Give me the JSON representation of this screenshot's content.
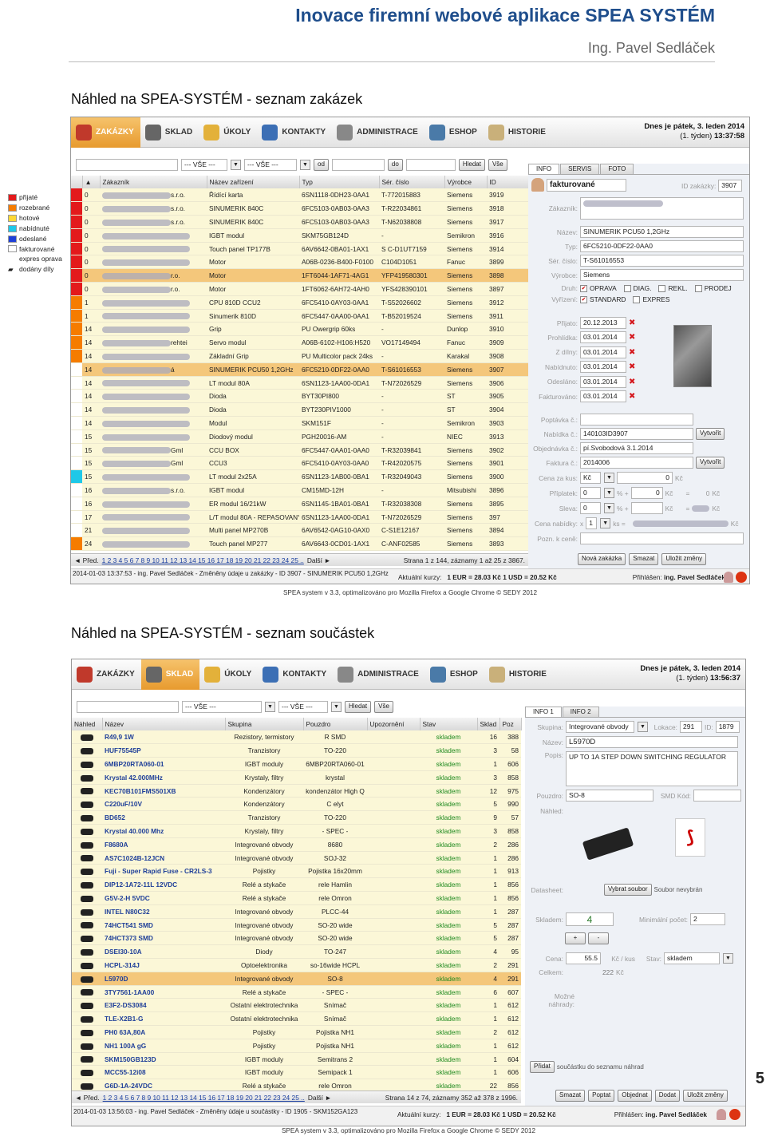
{
  "doc": {
    "title": "Inovace firemní webové aplikace SPEA SYSTÉM",
    "author": "Ing. Pavel Sedláček",
    "page_number": "5",
    "caption1": "Náhled na SPEA-SYSTÉM - seznam zakázek",
    "caption2": "Náhled na SPEA-SYSTÉM - seznam součástek"
  },
  "legend": [
    {
      "label": "přijaté",
      "color": "#e31a1c"
    },
    {
      "label": "rozebrané",
      "color": "#f57c00"
    },
    {
      "label": "hotové",
      "color": "#fdd835"
    },
    {
      "label": "nabídnuté",
      "color": "#1ec8e8"
    },
    {
      "label": "odeslané",
      "color": "#1e40d8"
    },
    {
      "label": "fakturované",
      "color": "#ffffff"
    },
    {
      "label": "expres oprava",
      "color": ""
    },
    {
      "label": "dodány díly",
      "color": ""
    }
  ],
  "nav": [
    "ZAKÁZKY",
    "SKLAD",
    "ÚKOLY",
    "KONTAKTY",
    "ADMINISTRACE",
    "ESHOP",
    "HISTORIE"
  ],
  "shot1": {
    "date1": "Dnes je pátek, 3. leden 2014",
    "week": "(1. týden)",
    "time": "13:37:58",
    "filter": {
      "all1": "--- VŠE ---",
      "all2": "--- VŠE ---",
      "od": "od",
      "do": "do",
      "search": "Hledat",
      "all_btn": "Vše"
    },
    "columns": [
      "Zákazník",
      "Název zařízení",
      "Typ",
      "Sér. číslo",
      "Výrobce",
      "ID"
    ],
    "rows": [
      {
        "c": "0",
        "cust": "s.r.o.",
        "name": "Řídící karta",
        "type": "6SN1118-0DH23-0AA1",
        "sn": "T-772015883",
        "mfr": "Siemens",
        "id": "3919",
        "flag": "#e31a1c"
      },
      {
        "c": "0",
        "cust": "s.r.o.",
        "name": "SINUMERIK 840C",
        "type": "6FC5103-0AB03-0AA3",
        "sn": "T-R22034861",
        "mfr": "Siemens",
        "id": "3918",
        "flag": "#e31a1c"
      },
      {
        "c": "0",
        "cust": "s.r.o.",
        "name": "SINUMERIK 840C",
        "type": "6FC5103-0AB03-0AA3",
        "sn": "T-N62038808",
        "mfr": "Siemens",
        "id": "3917",
        "flag": "#e31a1c"
      },
      {
        "c": "0",
        "cust": "",
        "name": "IGBT modul",
        "type": "SKM75GB124D",
        "sn": "-",
        "mfr": "Semikron",
        "id": "3916",
        "flag": "#e31a1c"
      },
      {
        "c": "0",
        "cust": "",
        "name": "Touch panel TP177B",
        "type": "6AV6642-0BA01-1AX1",
        "sn": "S C-D1UT7159",
        "mfr": "Siemens",
        "id": "3914",
        "flag": "#e31a1c"
      },
      {
        "c": "0",
        "cust": "",
        "name": "Motor",
        "type": "A06B-0236-B400-F0100",
        "sn": "C104D1051",
        "mfr": "Fanuc",
        "id": "3899",
        "flag": "#e31a1c"
      },
      {
        "c": "0",
        "cust": "r.o.",
        "name": "Motor",
        "type": "1FT6044-1AF71-4AG1",
        "sn": "YFP419580301",
        "mfr": "Siemens",
        "id": "3898",
        "flag": "#e31a1c",
        "sel": true
      },
      {
        "c": "0",
        "cust": "r.o.",
        "name": "Motor",
        "type": "1FT6062-6AH72-4AH0",
        "sn": "YFS428390101",
        "mfr": "Siemens",
        "id": "3897",
        "flag": "#e31a1c"
      },
      {
        "c": "1",
        "cust": "",
        "name": "CPU 810D CCU2",
        "type": "6FC5410-0AY03-0AA1",
        "sn": "T-S52026602",
        "mfr": "Siemens",
        "id": "3912",
        "flag": "#f57c00"
      },
      {
        "c": "1",
        "cust": "",
        "name": "Sinumerik 810D",
        "type": "6FC5447-0AA00-0AA1",
        "sn": "T-B52019524",
        "mfr": "Siemens",
        "id": "3911",
        "flag": "#f57c00"
      },
      {
        "c": "14",
        "cust": "",
        "name": "Grip",
        "type": "PU Owergrip 60ks",
        "sn": "-",
        "mfr": "Dunlop",
        "id": "3910",
        "flag": "#f57c00"
      },
      {
        "c": "14",
        "cust": "rehtei",
        "name": "Servo modul",
        "type": "A06B-6102-H106:H520",
        "sn": "VO17149494",
        "mfr": "Fanuc",
        "id": "3909",
        "flag": "#f57c00"
      },
      {
        "c": "14",
        "cust": "",
        "name": "Základní Grip",
        "type": "PU Multicolor pack 24ks",
        "sn": "-",
        "mfr": "Karakal",
        "id": "3908",
        "flag": "#f57c00"
      },
      {
        "c": "14",
        "cust": "á",
        "name": "SINUMERIK PCU50 1,2GHz",
        "type": "6FC5210-0DF22-0AA0",
        "sn": "T-S61016553",
        "mfr": "Siemens",
        "id": "3907",
        "flag": "#ffffff",
        "sel": true
      },
      {
        "c": "14",
        "cust": "",
        "name": "LT modul 80A",
        "type": "6SN1123-1AA00-0DA1",
        "sn": "T-N72026529",
        "mfr": "Siemens",
        "id": "3906",
        "flag": "#ffffff"
      },
      {
        "c": "14",
        "cust": "",
        "name": "Dioda",
        "type": "BYT30PI800",
        "sn": "-",
        "mfr": "ST",
        "id": "3905",
        "flag": "#ffffff"
      },
      {
        "c": "14",
        "cust": "",
        "name": "Dioda",
        "type": "BYT230PIV1000",
        "sn": "-",
        "mfr": "ST",
        "id": "3904",
        "flag": "#ffffff"
      },
      {
        "c": "14",
        "cust": "",
        "name": "Modul",
        "type": "SKM151F",
        "sn": "-",
        "mfr": "Semikron",
        "id": "3903",
        "flag": "#ffffff"
      },
      {
        "c": "15",
        "cust": "",
        "name": "Diodový modul",
        "type": "PGH20016-AM",
        "sn": "-",
        "mfr": "NIEC",
        "id": "3913",
        "flag": "#ffffff"
      },
      {
        "c": "15",
        "cust": "Gml",
        "name": "CCU BOX",
        "type": "6FC5447-0AA01-0AA0",
        "sn": "T-R32039841",
        "mfr": "Siemens",
        "id": "3902",
        "flag": "#ffffff"
      },
      {
        "c": "15",
        "cust": "Gml",
        "name": "CCU3",
        "type": "6FC5410-0AY03-0AA0",
        "sn": "T-R42020575",
        "mfr": "Siemens",
        "id": "3901",
        "flag": "#ffffff"
      },
      {
        "c": "15",
        "cust": "",
        "name": "LT modul 2x25A",
        "type": "6SN1123-1AB00-0BA1",
        "sn": "T-R32049043",
        "mfr": "Siemens",
        "id": "3900",
        "flag": "#1ec8e8"
      },
      {
        "c": "16",
        "cust": "s.r.o.",
        "name": "IGBT modul",
        "type": "CM15MD-12H",
        "sn": "-",
        "mfr": "Mitsubishi",
        "id": "3896",
        "flag": "#ffffff"
      },
      {
        "c": "16",
        "cust": "",
        "name": "ER modul 16/21kW",
        "type": "6SN1145-1BA01-0BA1",
        "sn": "T-R32038308",
        "mfr": "Siemens",
        "id": "3895",
        "flag": "#ffffff"
      },
      {
        "c": "17",
        "cust": "",
        "name": "L/T modul 80A - REPASOVANÝ",
        "type": "6SN1123-1AA00-0DA1",
        "sn": "T-N72026529",
        "mfr": "Siemens",
        "id": "397",
        "flag": "#ffffff"
      },
      {
        "c": "21",
        "cust": "",
        "name": "Multi panel MP270B",
        "type": "6AV6542-0AG10-0AX0",
        "sn": "C-S1E12167",
        "mfr": "Siemens",
        "id": "3894",
        "flag": "#ffffff"
      },
      {
        "c": "24",
        "cust": "",
        "name": "Touch panel MP277",
        "type": "6AV6643-0CD01-1AX1",
        "sn": "C-ANF02585",
        "mfr": "Siemens",
        "id": "3893",
        "flag": "#f57c00"
      }
    ],
    "pager": {
      "prev": "Před.",
      "pages": "1 2 3 4 5 6 7 8 9 10 11 12 13 14 15 16 17 18 19 20 21 22 23 24 25 ..",
      "next": "Další",
      "info": "Strana 1 z 144, záznamy 1 až 25 z 3867."
    },
    "status": {
      "log": "2014-01-03 13:37:53 - ing. Pavel Sedláček - Změněny údaje u zakázky - ID 3907 - SINUMERIK PCU50 1,2GHz",
      "rates": "Aktuální kurzy:",
      "rate_vals": "1 EUR = 28.03 Kč 1 USD = 20.52 Kč",
      "login_label": "Přihlášen:",
      "user": "ing. Pavel Sedláček"
    },
    "footer": "SPEA system v 3.3, optimalizováno pro Mozilla Firefox a Google Chrome © SEDY 2012",
    "panel": {
      "tabs": [
        "INFO",
        "SERVIS",
        "FOTO"
      ],
      "state": "fakturované",
      "id_label": "ID zakázky:",
      "id": "3907",
      "customer_label": "Zákazník:",
      "name_label": "Název:",
      "name": "SINUMERIK PCU50 1,2GHz",
      "type_label": "Typ:",
      "type": "6FC5210-0DF22-0AA0",
      "sn_label": "Sér. číslo:",
      "sn": "T-S61016553",
      "mfr_label": "Výrobce:",
      "mfr": "Siemens",
      "kind_label": "Druh:",
      "kind": [
        "OPRAVA",
        "DIAG.",
        "REKL.",
        "PRODEJ"
      ],
      "handle_label": "Vyřízení:",
      "handle": [
        "STANDARD",
        "EXPRES"
      ],
      "dates": [
        {
          "l": "Přijato:",
          "v": "20.12.2013"
        },
        {
          "l": "Prohlídka:",
          "v": "03.01.2014"
        },
        {
          "l": "Z dílny:",
          "v": "03.01.2014"
        },
        {
          "l": "Nabídnuto:",
          "v": "03.01.2014"
        },
        {
          "l": "Odesláno:",
          "v": "03.01.2014"
        },
        {
          "l": "Fakturováno:",
          "v": "03.01.2014"
        }
      ],
      "inquiry_label": "Poptávka č.:",
      "offer_label": "Nabídka č.:",
      "offer": "140103ID3907",
      "create": "Vytvořit",
      "order_label": "Objednávka č.:",
      "order": "pí.Svobodová 3.1.2014",
      "invoice_label": "Faktura č.:",
      "invoice": "2014006",
      "create2": "Vytvořit",
      "price_label": "Cena za kus:",
      "currency": "Kč",
      "price": "0",
      "price_unit": "Kč",
      "surcharge_label": "Příplatek:",
      "surcharge": "0",
      "pct": "% +",
      "surcharge_amt": "0",
      "sur_unit": "Kč",
      "eq": "=",
      "sur_total": "0",
      "sur_total_unit": "Kč",
      "discount_label": "Sleva:",
      "discount": "0",
      "pct2": "% +",
      "disc_unit": "Kč",
      "eq2": "=",
      "disc_total_unit": "Kč",
      "offer_price_label": "Cena nabídky:",
      "mult": "x",
      "qty": "1",
      "ks": "ks =",
      "op_unit": "Kč",
      "note_label": "Pozn. k ceně:",
      "buttons": [
        "Nová zakázka",
        "Smazat",
        "Uložit změny"
      ]
    }
  },
  "shot2": {
    "date1": "Dnes je pátek, 3. leden 2014",
    "week": "(1. týden)",
    "time": "13:56:37",
    "filter": {
      "all1": "--- VŠE ---",
      "all2": "--- VŠE ---",
      "search": "Hledat",
      "all_btn": "Vše"
    },
    "columns": [
      "Náhled",
      "Název",
      "Skupina",
      "Pouzdro",
      "Upozornění",
      "Stav",
      "Sklad",
      "Poz"
    ],
    "rows": [
      {
        "n": "R49,9 1W",
        "g": "Rezistory, termistory",
        "p": "R SMD",
        "s": "skladem",
        "q": "16",
        "pz": "388"
      },
      {
        "n": "HUF75545P",
        "g": "Tranzistory",
        "p": "TO-220",
        "s": "skladem",
        "q": "3",
        "pz": "58"
      },
      {
        "n": "6MBP20RTA060-01",
        "g": "IGBT moduly",
        "p": "6MBP20RTA060-01",
        "s": "skladem",
        "q": "1",
        "pz": "606"
      },
      {
        "n": "Krystal 42.000MHz",
        "g": "Krystaly, filtry",
        "p": "krystal",
        "s": "skladem",
        "q": "3",
        "pz": "858"
      },
      {
        "n": "KEC70B101FMS501XB",
        "g": "Kondenzátory",
        "p": "kondenzátor High Q",
        "s": "skladem",
        "q": "12",
        "pz": "975"
      },
      {
        "n": "C220uF/10V",
        "g": "Kondenzátory",
        "p": "C elyt",
        "s": "skladem",
        "q": "5",
        "pz": "990"
      },
      {
        "n": "BD652",
        "g": "Tranzistory",
        "p": "TO-220",
        "s": "skladem",
        "q": "9",
        "pz": "57"
      },
      {
        "n": "Krystal 40.000 Mhz",
        "g": "Krystaly, filtry",
        "p": "- SPEC -",
        "s": "skladem",
        "q": "3",
        "pz": "858"
      },
      {
        "n": "F8680A",
        "g": "Integrované obvody",
        "p": "8680",
        "s": "skladem",
        "q": "2",
        "pz": "286"
      },
      {
        "n": "AS7C1024B-12JCN",
        "g": "Integrované obvody",
        "p": "SOJ-32",
        "s": "skladem",
        "q": "1",
        "pz": "286"
      },
      {
        "n": "Fuji - Super Rapid Fuse - CR2LS-3",
        "g": "Pojistky",
        "p": "Pojistka 16x20mm",
        "s": "skladem",
        "q": "1",
        "pz": "913"
      },
      {
        "n": "DIP12-1A72-11L 12VDC",
        "g": "Relé a stykače",
        "p": "rele Hamlin",
        "s": "skladem",
        "q": "1",
        "pz": "856"
      },
      {
        "n": "G5V-2-H 5VDC",
        "g": "Relé a stykače",
        "p": "rele Omron",
        "s": "skladem",
        "q": "1",
        "pz": "856"
      },
      {
        "n": "INTEL N80C32",
        "g": "Integrované obvody",
        "p": "PLCC-44",
        "s": "skladem",
        "q": "1",
        "pz": "287"
      },
      {
        "n": "74HCT541 SMD",
        "g": "Integrované obvody",
        "p": "SO-20 wide",
        "s": "skladem",
        "q": "5",
        "pz": "287"
      },
      {
        "n": "74HCT373 SMD",
        "g": "Integrované obvody",
        "p": "SO-20 wide",
        "s": "skladem",
        "q": "5",
        "pz": "287"
      },
      {
        "n": "DSEI30-10A",
        "g": "Diody",
        "p": "TO-247",
        "s": "skladem",
        "q": "4",
        "pz": "95"
      },
      {
        "n": "HCPL-314J",
        "g": "Optoelektronika",
        "p": "so-16wide HCPL",
        "s": "skladem",
        "q": "2",
        "pz": "291"
      },
      {
        "n": "L5970D",
        "g": "Integrované obvody",
        "p": "SO-8",
        "s": "skladem",
        "q": "4",
        "pz": "291",
        "sel": true
      },
      {
        "n": "3TY7561-1AA00",
        "g": "Relé a stykače",
        "p": "- SPEC -",
        "s": "skladem",
        "q": "6",
        "pz": "607"
      },
      {
        "n": "E3F2-DS3084",
        "g": "Ostatní elektrotechnika",
        "p": "Snímač",
        "s": "skladem",
        "q": "1",
        "pz": "612"
      },
      {
        "n": "TLE-X2B1-G",
        "g": "Ostatní elektrotechnika",
        "p": "Snímač",
        "s": "skladem",
        "q": "1",
        "pz": "612"
      },
      {
        "n": "PH0 63A,80A",
        "g": "Pojistky",
        "p": "Pojistka NH1",
        "s": "skladem",
        "q": "2",
        "pz": "612"
      },
      {
        "n": "NH1 100A gG",
        "g": "Pojistky",
        "p": "Pojistka NH1",
        "s": "skladem",
        "q": "1",
        "pz": "612"
      },
      {
        "n": "SKM150GB123D",
        "g": "IGBT moduly",
        "p": "Semitrans 2",
        "s": "skladem",
        "q": "1",
        "pz": "604"
      },
      {
        "n": "MCC55-12i08",
        "g": "IGBT moduly",
        "p": "Semipack 1",
        "s": "skladem",
        "q": "1",
        "pz": "606"
      },
      {
        "n": "G6D-1A-24VDC",
        "g": "Relé a stykače",
        "p": "rele Omron",
        "s": "skladem",
        "q": "22",
        "pz": "856"
      }
    ],
    "pager": {
      "prev": "Před.",
      "pages": "1 2 3 4 5 6 7 8 9 10 11 12 13 14 15 16 17 18 19 20 21 22 23 24 25 ..",
      "next": "Další",
      "info": "Strana 14 z 74, záznamy 352 až 378 z 1996."
    },
    "status": {
      "log": "2014-01-03 13:56:03 - ing. Pavel Sedláček - Změněny údaje u součástky - ID 1905 - SKM152GA123",
      "rates": "Aktuální kurzy:",
      "rate_vals": "1 EUR = 28.03 Kč 1 USD = 20.52 Kč",
      "login_label": "Přihlášen:",
      "user": "ing. Pavel Sedláček"
    },
    "footer": "SPEA system v 3.3, optimalizováno pro Mozilla Firefox a Google Chrome © SEDY 2012",
    "panel": {
      "tabs": [
        "INFO 1",
        "INFO 2"
      ],
      "group_label": "Skupina:",
      "group": "Integrované obvody",
      "loc_label": "Lokace:",
      "loc": "291",
      "id_label": "ID:",
      "id": "1879",
      "name_label": "Název:",
      "name": "L5970D",
      "desc_label": "Popis:",
      "desc": "UP TO 1A STEP DOWN SWITCHING REGULATOR",
      "case_label": "Pouzdro:",
      "case": "SO-8",
      "smd_label": "SMD Kód:",
      "preview_label": "Náhled:",
      "ds_label": "Datasheet:",
      "ds_btn": "Vybrat soubor",
      "ds_none": "Soubor nevybrán",
      "stock_label": "Skladem:",
      "stock": "4",
      "min_label": "Minimální počet:",
      "min": "2",
      "plus": "+",
      "minus": "-",
      "price_label": "Cena:",
      "price": "55.5",
      "price_unit": "Kč / kus",
      "state_label": "Stav:",
      "state": "skladem",
      "total_label": "Celkem:",
      "total": "222",
      "total_unit": "Kč",
      "alt_label": "Možné náhrady:",
      "add_btn": "Přidat",
      "add_note": "součástku do seznamu náhrad",
      "buttons": [
        "Smazat",
        "Poptat",
        "Objednat",
        "Dodat",
        "Uložit změny"
      ]
    }
  }
}
